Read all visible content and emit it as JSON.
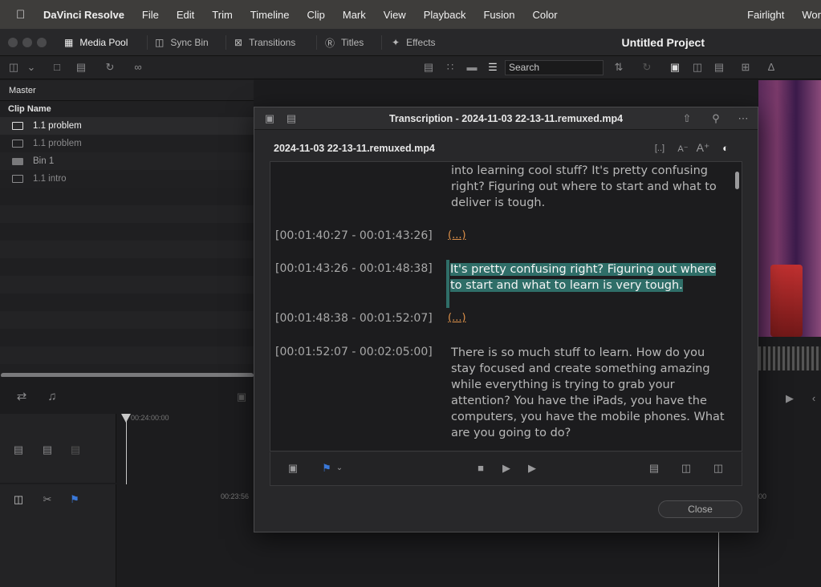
{
  "menubar": {
    "apple": "",
    "app_name": "DaVinci Resolve",
    "items": [
      "File",
      "Edit",
      "Trim",
      "Timeline",
      "Clip",
      "Mark",
      "View",
      "Playback",
      "Fusion",
      "Color"
    ],
    "right_items": [
      "Fairlight",
      "Wor"
    ]
  },
  "topbar": {
    "tabs": [
      {
        "label": "Media Pool",
        "icon": "media-pool-icon"
      },
      {
        "label": "Sync Bin",
        "icon": "sync-bin-icon"
      },
      {
        "label": "Transitions",
        "icon": "transitions-icon"
      },
      {
        "label": "Titles",
        "icon": "titles-icon"
      },
      {
        "label": "Effects",
        "icon": "effects-icon"
      }
    ],
    "project_title": "Untitled Project"
  },
  "toolbar": {
    "search_placeholder": "Search"
  },
  "media_pool": {
    "bin_name": "Master",
    "column_header": "Clip Name",
    "clips": [
      {
        "name": "1.1 problem",
        "type": "timeline",
        "selected": true
      },
      {
        "name": "1.1 problem",
        "type": "timeline",
        "selected": false
      },
      {
        "name": "Bin 1",
        "type": "folder",
        "selected": false
      },
      {
        "name": "1.1 intro",
        "type": "timeline",
        "selected": false
      }
    ]
  },
  "timeline": {
    "ruler_tc": "00:24:00:00",
    "ruler_tc2": "00:23:56",
    "ruler_tc3": "00"
  },
  "dialog": {
    "title": "Transcription - 2024-11-03 22-13-11.remuxed.mp4",
    "filename": "2024-11-03 22-13-11.remuxed.mp4",
    "segments": [
      {
        "timestamp": "",
        "text": "into learning cool stuff? It's pretty confusing right? Figuring out where to start and what to deliver is tough."
      },
      {
        "timestamp": "[00:01:40:27 - 00:01:43:26]",
        "text": "(...)"
      },
      {
        "timestamp": "[00:01:43:26 - 00:01:48:38]",
        "text": "It's pretty confusing right? Figuring out where to start and what to learn is very tough."
      },
      {
        "timestamp": "[00:01:48:38 - 00:01:52:07]",
        "text": "(...)"
      },
      {
        "timestamp": "[00:01:52:07 - 00:02:05:00]",
        "text": "There is so much stuff to learn. How do you stay focused and create something amazing while everything is trying to grab your attention? You have the iPads, you have the computers, you have the mobile phones. What are you going to do?"
      }
    ],
    "close_label": "Close",
    "accent_color": "#2f6e68",
    "silence_color": "#e0924a"
  }
}
